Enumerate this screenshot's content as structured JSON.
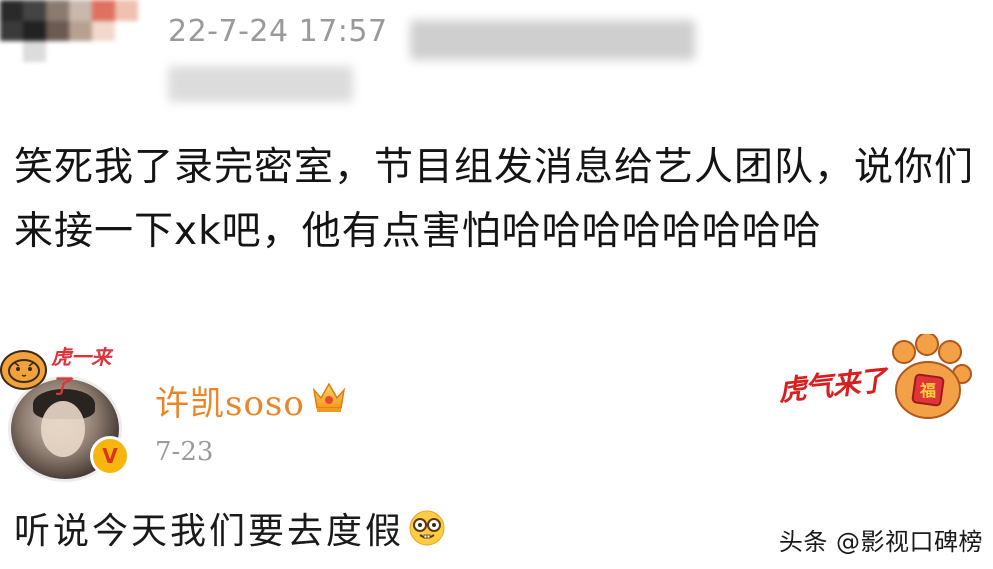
{
  "post": {
    "timestamp": "22-7-24 17:57",
    "body": "笑死我了录完密室，节目组发消息给艺人团队，说你们来接一下xk吧，他有点害怕哈哈哈哈哈哈哈哈"
  },
  "reply": {
    "username": "许凯soso",
    "date": "7-23",
    "text": "听说今天我们要去度假",
    "avatar_sticker_text": "虎一来了",
    "verified_glyph": "V"
  },
  "decoration": {
    "tiger_sticker_text": "虎气来了"
  },
  "watermark": "头条 @影视口碑榜",
  "colors": {
    "username": "#eb8528",
    "badge": "#f6b60f",
    "sticker_red": "#d81e1e",
    "timestamp_gray": "#9a9a9a"
  },
  "icons": {
    "crown": "crown-icon",
    "emoji": "nerd-face-emoji-icon",
    "verified": "verified-badge-icon",
    "paw": "tiger-paw-icon"
  }
}
